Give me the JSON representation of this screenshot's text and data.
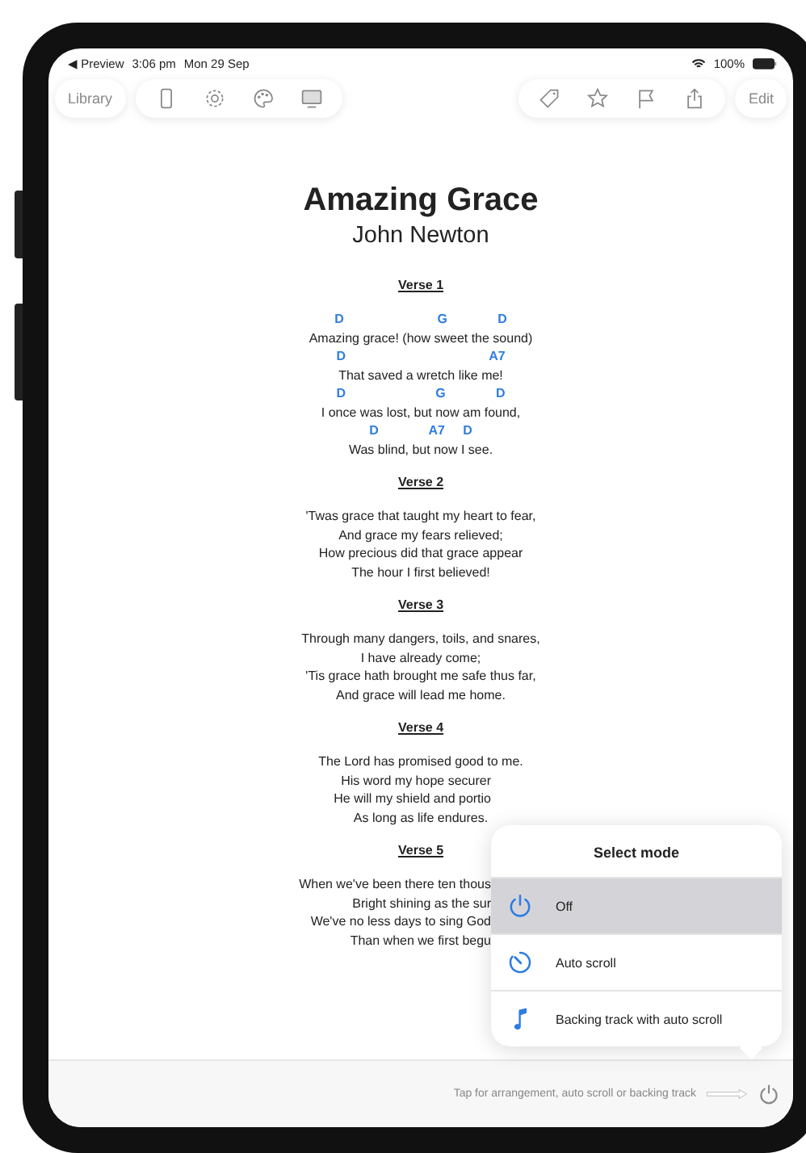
{
  "status_bar": {
    "back": "◀ Preview",
    "time": "3:06 pm",
    "date": "Mon 29 Sep",
    "battery": "100%"
  },
  "toolbar": {
    "library": "Library",
    "edit": "Edit"
  },
  "song": {
    "title": "Amazing Grace",
    "author": "John Newton",
    "verses": [
      {
        "heading": "Verse 1",
        "lines": [
          {
            "kind": "chords",
            "text": "D                          G              D"
          },
          {
            "kind": "lyric",
            "text": "Amazing grace! (how sweet the sound)"
          },
          {
            "kind": "chords",
            "text": "D                                        A7"
          },
          {
            "kind": "lyric",
            "text": "That saved a wretch like me!"
          },
          {
            "kind": "chords",
            "text": "D                         G              D"
          },
          {
            "kind": "lyric",
            "text": "I once was lost, but now am found,"
          },
          {
            "kind": "chords",
            "text": "D              A7     D"
          },
          {
            "kind": "lyric",
            "text": "Was blind, but now I see."
          }
        ]
      },
      {
        "heading": "Verse 2",
        "lines": [
          {
            "kind": "lyric",
            "text": "'Twas grace that taught my heart to fear,"
          },
          {
            "kind": "lyric",
            "text": "And grace my fears relieved;"
          },
          {
            "kind": "lyric",
            "text": "How precious did that grace appear"
          },
          {
            "kind": "lyric",
            "text": "The hour I first believed!"
          }
        ]
      },
      {
        "heading": "Verse 3",
        "lines": [
          {
            "kind": "lyric",
            "text": "Through many dangers, toils, and snares,"
          },
          {
            "kind": "lyric",
            "text": "I have already come;"
          },
          {
            "kind": "lyric",
            "text": "'Tis grace hath brought me safe thus far,"
          },
          {
            "kind": "lyric",
            "text": "And grace will lead me home."
          }
        ]
      },
      {
        "heading": "Verse 4",
        "lines": [
          {
            "kind": "lyric",
            "text": "The Lord has promised good to me."
          },
          {
            "kind": "cut",
            "text": "His word my hope securer"
          },
          {
            "kind": "cut",
            "text": "He will my shield and portio"
          },
          {
            "kind": "lyric",
            "text": "As long as life endures."
          }
        ]
      },
      {
        "heading": "Verse 5",
        "lines": [
          {
            "kind": "cut",
            "text": "When we've been there ten thous"
          },
          {
            "kind": "cut",
            "text": "Bright shining as the sur"
          },
          {
            "kind": "cut",
            "text": "We've no less days to sing God"
          },
          {
            "kind": "cut",
            "text": "Than when we first begu"
          }
        ]
      }
    ]
  },
  "mode_menu": {
    "title": "Select mode",
    "items": [
      {
        "kind": "power",
        "label": "Off",
        "selected": true
      },
      {
        "kind": "timer",
        "label": "Auto scroll",
        "selected": false
      },
      {
        "kind": "note",
        "label": "Backing track with auto scroll",
        "selected": false
      }
    ]
  },
  "bottom_bar": {
    "hint": "Tap for arrangement, auto scroll or backing track"
  }
}
